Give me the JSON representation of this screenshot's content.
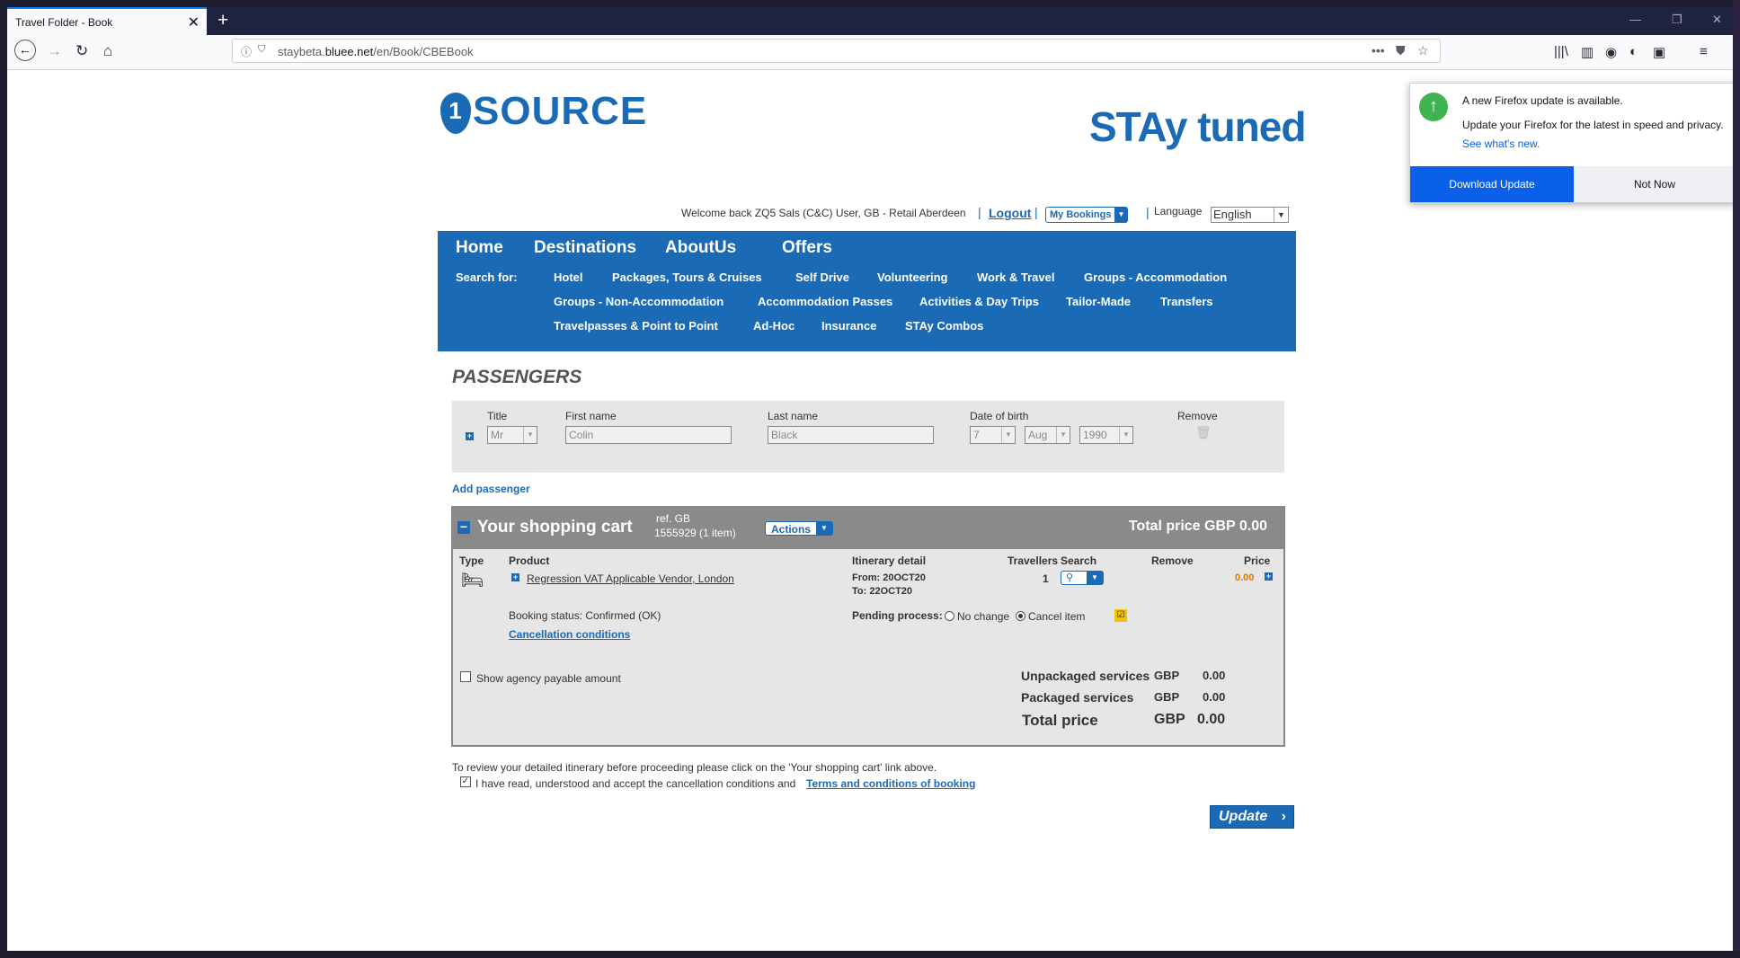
{
  "browser": {
    "tab_title": "Travel Folder - Book",
    "url_host": "staybeta.",
    "url_domain": "bluee.net",
    "url_path": "/en/Book/CBEBook"
  },
  "header": {
    "logo_left": "SOURCE",
    "logo_left_pin": "1",
    "logo_right": "STAy tuned",
    "welcome": "Welcome back ZQ5 Sals (C&C) User, GB - Retail Aberdeen",
    "logout": "Logout",
    "my_bookings": "My Bookings",
    "language_label": "Language",
    "language_value": "English"
  },
  "menu": {
    "main": [
      "Home",
      "Destinations",
      "AboutUs",
      "Offers"
    ],
    "search_for": "Search for:",
    "sub": [
      "Hotel",
      "Packages, Tours & Cruises",
      "Self Drive",
      "Volunteering",
      "Work & Travel",
      "Groups - Accommodation",
      "Groups - Non-Accommodation",
      "Accommodation Passes",
      "Activities & Day Trips",
      "Tailor-Made",
      "Transfers",
      "Travelpasses & Point to Point",
      "Ad-Hoc",
      "Insurance",
      "STAy Combos"
    ]
  },
  "passengers": {
    "heading": "PASSENGERS",
    "labels": {
      "title": "Title",
      "first": "First name",
      "last": "Last name",
      "dob": "Date of birth",
      "remove": "Remove"
    },
    "title": "Mr",
    "first_name": "Colin",
    "last_name": "Black",
    "dob_day": "7",
    "dob_month": "Aug",
    "dob_year": "1990",
    "add": "Add passenger"
  },
  "cart": {
    "title": "Your shopping cart",
    "ref_line1": "ref. GB",
    "ref_line2": "1555929 (1 item)",
    "actions": "Actions",
    "total_header": "Total price GBP 0.00",
    "columns": {
      "type": "Type",
      "product": "Product",
      "itinerary": "Itinerary detail",
      "travellers": "Travellers",
      "search": "Search",
      "remove": "Remove",
      "price": "Price"
    },
    "product": "Regression VAT Applicable Vendor, London",
    "from": "From: 20OCT20",
    "to": "To: 22OCT20",
    "travellers": "1",
    "price": "0.00",
    "booking_status": "Booking status: Confirmed (OK)",
    "cancellation": "Cancellation conditions",
    "pending_label": "Pending process:",
    "no_change": "No change",
    "cancel_item": "Cancel item",
    "show_agency": "Show agency payable amount",
    "summary": [
      {
        "label": "Unpackaged services",
        "cur": "GBP",
        "value": "0.00"
      },
      {
        "label": "Packaged services",
        "cur": "GBP",
        "value": "0.00"
      },
      {
        "label": "Total price",
        "cur": "GBP",
        "value": "0.00"
      }
    ]
  },
  "footer": {
    "review_note": "To review your detailed itinerary before proceeding please click on the 'Your shopping cart' link above.",
    "accept_text": "I have read, understood and accept the cancellation conditions and",
    "terms_link": "Terms and conditions of booking",
    "update": "Update"
  },
  "popup": {
    "title": "A new Firefox update is available.",
    "body": "Update your Firefox for the latest in speed and privacy.",
    "link": "See what's new.",
    "download": "Download Update",
    "not_now": "Not Now"
  },
  "colors": {
    "brand_blue": "#1a6ab5",
    "cart_header": "#8a8a8a",
    "price_orange": "#e07800",
    "update_green": "#3fb34f"
  }
}
